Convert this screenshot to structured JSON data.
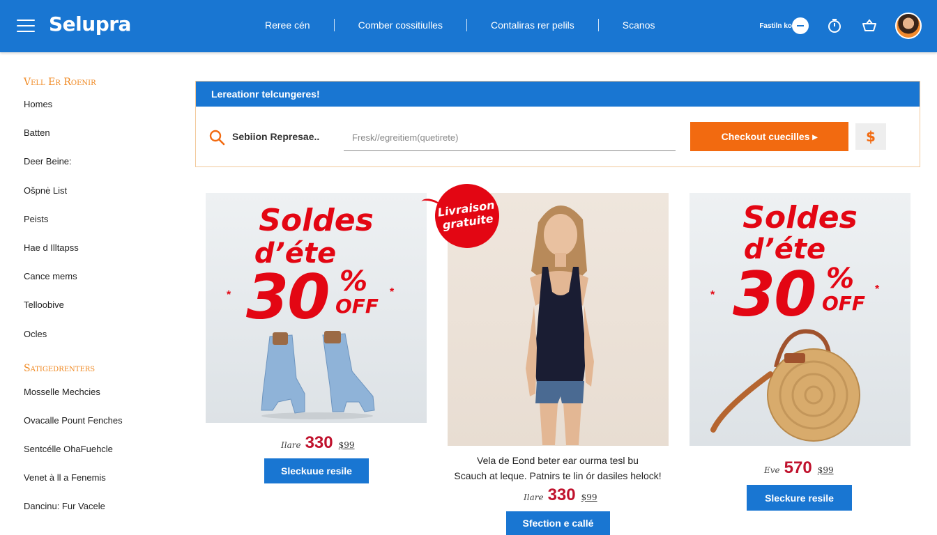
{
  "header": {
    "brand": "Selupra",
    "nav": [
      "Reree cén",
      "Comber cossitiulles",
      "Contaliras rer pelils",
      "Scanos"
    ],
    "account_label": "Fastiln ko",
    "brand_color": "#1976d2",
    "icons": [
      "menu-icon",
      "timer-icon",
      "cart-icon"
    ]
  },
  "sidebar": {
    "section1": "Vell Er Roenir",
    "items1": [
      "Homes",
      "Batten",
      "Deer Beine:",
      "Ošpnė List",
      "Peists",
      "Hae d Illtapss",
      "Cance mems",
      "Telloobive",
      "Ocles"
    ],
    "section2": "Satigedrenters",
    "items2": [
      "Mosselle Mechcies",
      "Ovacalle Pount Fenches",
      "Sentcélle OhaFuehcle",
      "Venet à ll a Fenemis",
      "Dancinu: Fur Vacele"
    ]
  },
  "promo": {
    "banner": "Lereationr telcungeres!",
    "search_label": "Sebiion Represae..",
    "search_placeholder": "Fresk//egreitiem(quetirete)",
    "checkout_label": "Checkout cuecilles ▸",
    "dollar_label": "$",
    "accent_color": "#f26a10"
  },
  "products": [
    {
      "headline1": "Soldes",
      "headline2": "d’éte",
      "percent": "30",
      "percent_sign": "%",
      "off": "OFF",
      "price_pre": "Ilare",
      "price": "330",
      "price_old": "$99",
      "button": "Sleckuue resile"
    },
    {
      "badge1": "Livraison",
      "badge2": "gratuite",
      "desc1": "Vela de Eond beter ear ourma tesl bu",
      "desc2": "Scauch at leque. Patnirs te lin ór dasiles helock!",
      "price_pre": "Ilare",
      "price": "330",
      "price_old": "$99",
      "button": "Sfection e callé"
    },
    {
      "headline1": "Soldes",
      "headline2": "d’éte",
      "percent": "30",
      "percent_sign": "%",
      "off": "OFF",
      "price_pre": "Eve",
      "price": "570",
      "price_old": "$99",
      "button": "Sleckure resile"
    }
  ]
}
